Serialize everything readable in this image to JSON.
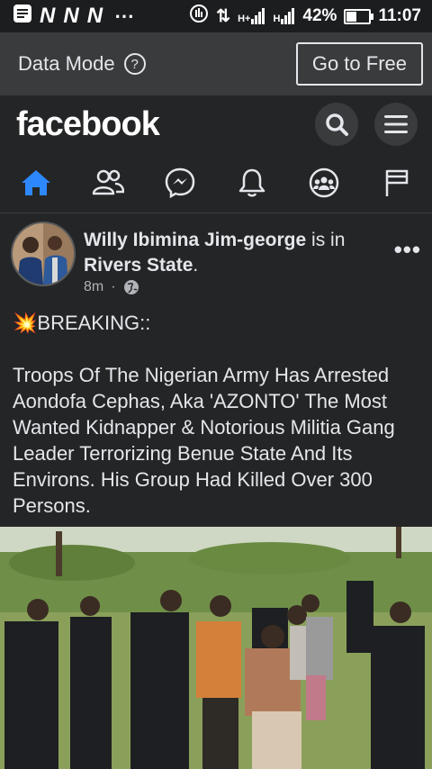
{
  "status_bar": {
    "n_icons": [
      "N",
      "N",
      "N"
    ],
    "overflow": "⋯",
    "network_a": "⇅",
    "signal_h_plus": "H+",
    "signal_h": "H",
    "battery_level": 0.42,
    "battery_percent": "42%",
    "time": "11:07"
  },
  "data_mode_bar": {
    "label": "Data Mode",
    "help_glyph": "?",
    "go_to_free": "Go to Free"
  },
  "header": {
    "logo": "facebook"
  },
  "tabs": [
    {
      "name": "home",
      "active": true
    },
    {
      "name": "friends",
      "active": false
    },
    {
      "name": "messenger",
      "active": false
    },
    {
      "name": "notifications",
      "active": false
    },
    {
      "name": "groups",
      "active": false
    },
    {
      "name": "pages",
      "active": false
    }
  ],
  "post": {
    "author": "Willy Ibimina Jim-george",
    "connector": " is in ",
    "location": "Rivers State",
    "location_suffix": ".",
    "time": "8m",
    "separator": "·",
    "more": "•••",
    "text": "💥BREAKING::\n\nTroops Of The Nigerian Army Has Arrested Aondofa Cephas, Aka 'AZONTO' The Most Wanted Kidnapper & Notorious Militia Gang Leader Terrorizing Benue State And Its Environs. His Group Had Killed Over 300 Persons."
  },
  "colors": {
    "accent": "#2d88ff",
    "background": "#242526",
    "bar": "#3a3b3c"
  }
}
